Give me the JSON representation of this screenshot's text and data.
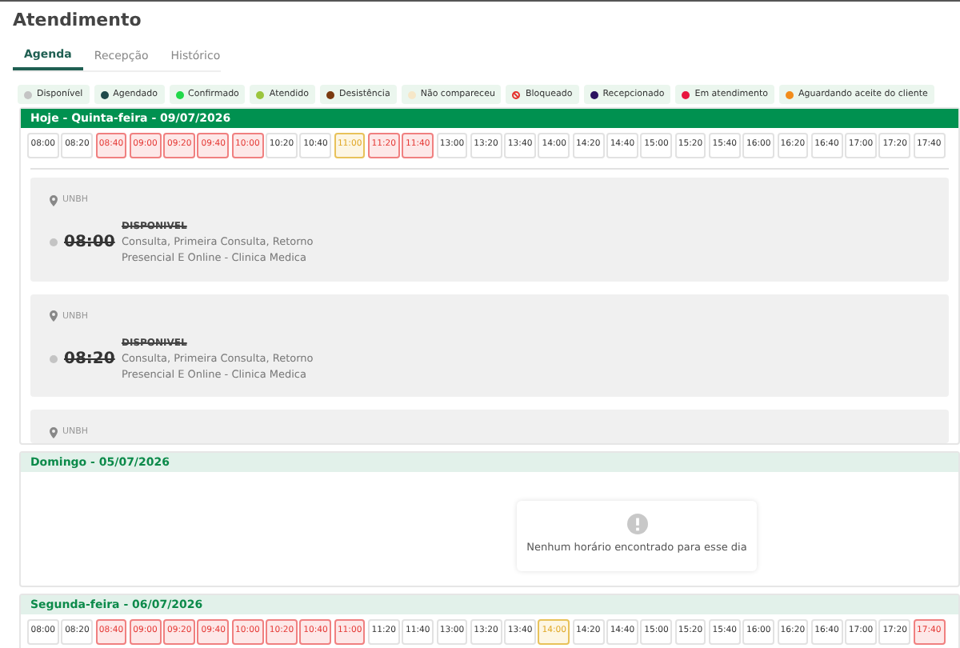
{
  "title": "Atendimento",
  "tabs": [
    {
      "label": "Agenda",
      "selected": true
    },
    {
      "label": "Recepção",
      "selected": false
    },
    {
      "label": "Histórico",
      "selected": false
    }
  ],
  "legend": [
    {
      "label": "Disponível",
      "color": "#c4c4c4",
      "kind": "dot"
    },
    {
      "label": "Agendado",
      "color": "#1f4a4a",
      "kind": "dot"
    },
    {
      "label": "Confirmado",
      "color": "#22d84a",
      "kind": "dot"
    },
    {
      "label": "Atendido",
      "color": "#9bc53d",
      "kind": "dot"
    },
    {
      "label": "Desistência",
      "color": "#7a3a10",
      "kind": "dot"
    },
    {
      "label": "Não compareceu",
      "color": "#f6e7c8",
      "kind": "dot"
    },
    {
      "label": "Bloqueado",
      "color": "#e5322d",
      "kind": "blocked"
    },
    {
      "label": "Recepcionado",
      "color": "#2b1360",
      "kind": "dot"
    },
    {
      "label": "Em atendimento",
      "color": "#e8173f",
      "kind": "dot"
    },
    {
      "label": "Aguardando aceite do cliente",
      "color": "#f28c1b",
      "kind": "dot"
    }
  ],
  "days": [
    {
      "header": "Hoje - Quinta-feira - 09/07/2026",
      "today": true,
      "slots": [
        {
          "time": "08:00",
          "kind": "free"
        },
        {
          "time": "08:20",
          "kind": "free"
        },
        {
          "time": "08:40",
          "kind": "busy"
        },
        {
          "time": "09:00",
          "kind": "busy"
        },
        {
          "time": "09:20",
          "kind": "busy"
        },
        {
          "time": "09:40",
          "kind": "busy"
        },
        {
          "time": "10:00",
          "kind": "busy"
        },
        {
          "time": "10:20",
          "kind": "free"
        },
        {
          "time": "10:40",
          "kind": "free"
        },
        {
          "time": "11:00",
          "kind": "pending"
        },
        {
          "time": "11:20",
          "kind": "busy"
        },
        {
          "time": "11:40",
          "kind": "busy"
        },
        {
          "time": "13:00",
          "kind": "free"
        },
        {
          "time": "13:20",
          "kind": "free"
        },
        {
          "time": "13:40",
          "kind": "free"
        },
        {
          "time": "14:00",
          "kind": "free"
        },
        {
          "time": "14:20",
          "kind": "free"
        },
        {
          "time": "14:40",
          "kind": "free"
        },
        {
          "time": "15:00",
          "kind": "free"
        },
        {
          "time": "15:20",
          "kind": "free"
        },
        {
          "time": "15:40",
          "kind": "free"
        },
        {
          "time": "16:00",
          "kind": "free"
        },
        {
          "time": "16:20",
          "kind": "free"
        },
        {
          "time": "16:40",
          "kind": "free"
        },
        {
          "time": "17:00",
          "kind": "free"
        },
        {
          "time": "17:20",
          "kind": "free"
        },
        {
          "time": "17:40",
          "kind": "free"
        }
      ],
      "appointments": [
        {
          "location": "UNBH",
          "time": "08:00",
          "status": "DISPONIVEL",
          "color": "#c4c4c4",
          "services": "Consulta, Primeira Consulta, Retorno",
          "mode": "Presencial E Online - Clinica Medica"
        },
        {
          "location": "UNBH",
          "time": "08:20",
          "status": "DISPONIVEL",
          "color": "#c4c4c4",
          "services": "Consulta, Primeira Consulta, Retorno",
          "mode": "Presencial E Online - Clinica Medica"
        },
        {
          "location": "UNBH"
        }
      ]
    },
    {
      "header": "Domingo - 05/07/2026",
      "today": false,
      "empty_message": "Nenhum horário encontrado para esse dia"
    },
    {
      "header": "Segunda-feira - 06/07/2026",
      "today": false,
      "slots": [
        {
          "time": "08:00",
          "kind": "free"
        },
        {
          "time": "08:20",
          "kind": "free"
        },
        {
          "time": "08:40",
          "kind": "busy"
        },
        {
          "time": "09:00",
          "kind": "busy"
        },
        {
          "time": "09:20",
          "kind": "busy"
        },
        {
          "time": "09:40",
          "kind": "busy"
        },
        {
          "time": "10:00",
          "kind": "busy"
        },
        {
          "time": "10:20",
          "kind": "busy"
        },
        {
          "time": "10:40",
          "kind": "busy"
        },
        {
          "time": "11:00",
          "kind": "busy"
        },
        {
          "time": "11:20",
          "kind": "free"
        },
        {
          "time": "11:40",
          "kind": "free"
        },
        {
          "time": "13:00",
          "kind": "free"
        },
        {
          "time": "13:20",
          "kind": "free"
        },
        {
          "time": "13:40",
          "kind": "free"
        },
        {
          "time": "14:00",
          "kind": "pending"
        },
        {
          "time": "14:20",
          "kind": "free"
        },
        {
          "time": "14:40",
          "kind": "free"
        },
        {
          "time": "15:00",
          "kind": "free"
        },
        {
          "time": "15:20",
          "kind": "free"
        },
        {
          "time": "15:40",
          "kind": "free"
        },
        {
          "time": "16:00",
          "kind": "free"
        },
        {
          "time": "16:20",
          "kind": "free"
        },
        {
          "time": "16:40",
          "kind": "free"
        },
        {
          "time": "17:00",
          "kind": "free"
        },
        {
          "time": "17:20",
          "kind": "free"
        },
        {
          "time": "17:40",
          "kind": "busy"
        }
      ]
    }
  ]
}
